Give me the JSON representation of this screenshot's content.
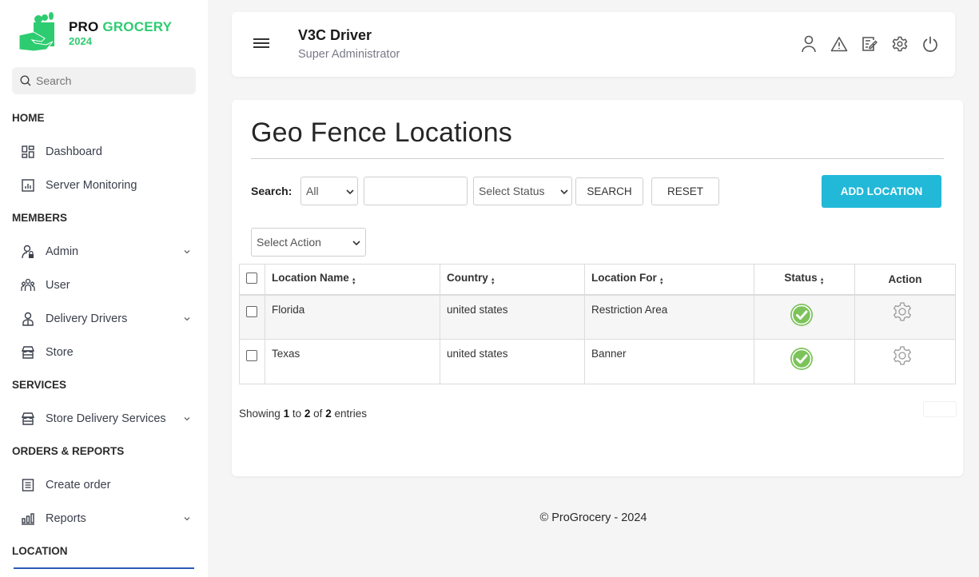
{
  "brand": {
    "pro": "PRO",
    "grocery": "GROCERY",
    "year": "2024"
  },
  "sidebar": {
    "search_placeholder": "Search",
    "sections": {
      "home": "HOME",
      "members": "MEMBERS",
      "services": "SERVICES",
      "orders_reports": "ORDERS & REPORTS",
      "location": "LOCATION"
    },
    "items": [
      {
        "label": "Dashboard",
        "icon": "dashboard-icon",
        "has_submenu": false
      },
      {
        "label": "Server Monitoring",
        "icon": "chart-icon",
        "has_submenu": false
      },
      {
        "label": "Admin",
        "icon": "admin-icon",
        "has_submenu": true
      },
      {
        "label": "User",
        "icon": "users-icon",
        "has_submenu": false
      },
      {
        "label": "Delivery Drivers",
        "icon": "driver-icon",
        "has_submenu": true
      },
      {
        "label": "Store",
        "icon": "store-icon",
        "has_submenu": false
      },
      {
        "label": "Store Delivery Services",
        "icon": "store-icon",
        "has_submenu": true
      },
      {
        "label": "Create order",
        "icon": "document-icon",
        "has_submenu": false
      },
      {
        "label": "Reports",
        "icon": "bar-chart-icon",
        "has_submenu": true
      }
    ]
  },
  "header": {
    "user_name": "V3C Driver",
    "user_role": "Super Administrator",
    "icons": [
      "user-icon",
      "alert-icon",
      "edit-icon",
      "settings-icon",
      "power-icon"
    ]
  },
  "main": {
    "title": "Geo Fence Locations",
    "search_label": "Search:",
    "filter_field": {
      "selected": "All",
      "options": [
        "All"
      ]
    },
    "search_input": {
      "value": "",
      "placeholder": ""
    },
    "status_select": {
      "selected": "Select Status",
      "options": [
        "Select Status"
      ]
    },
    "search_button": "SEARCH",
    "reset_button": "RESET",
    "add_button": "ADD LOCATION",
    "action_select": {
      "selected": "Select Action",
      "options": [
        "Select Action"
      ]
    },
    "table": {
      "columns": [
        "Location Name",
        "Country",
        "Location For",
        "Status",
        "Action"
      ],
      "rows": [
        {
          "name": "Florida",
          "country": "united states",
          "location_for": "Restriction Area",
          "status": "active"
        },
        {
          "name": "Texas",
          "country": "united states",
          "location_for": "Banner",
          "status": "active"
        }
      ]
    },
    "entries": {
      "prefix": "Showing",
      "from": "1",
      "to_word": "to",
      "to": "2",
      "of_word": "of",
      "total": "2",
      "suffix": "entries"
    }
  },
  "colors": {
    "accent": "#22b8d8",
    "brand_green": "#2ecc71",
    "status_active": "#7cc35a"
  },
  "footer": {
    "text": "© ProGrocery - 2024"
  }
}
